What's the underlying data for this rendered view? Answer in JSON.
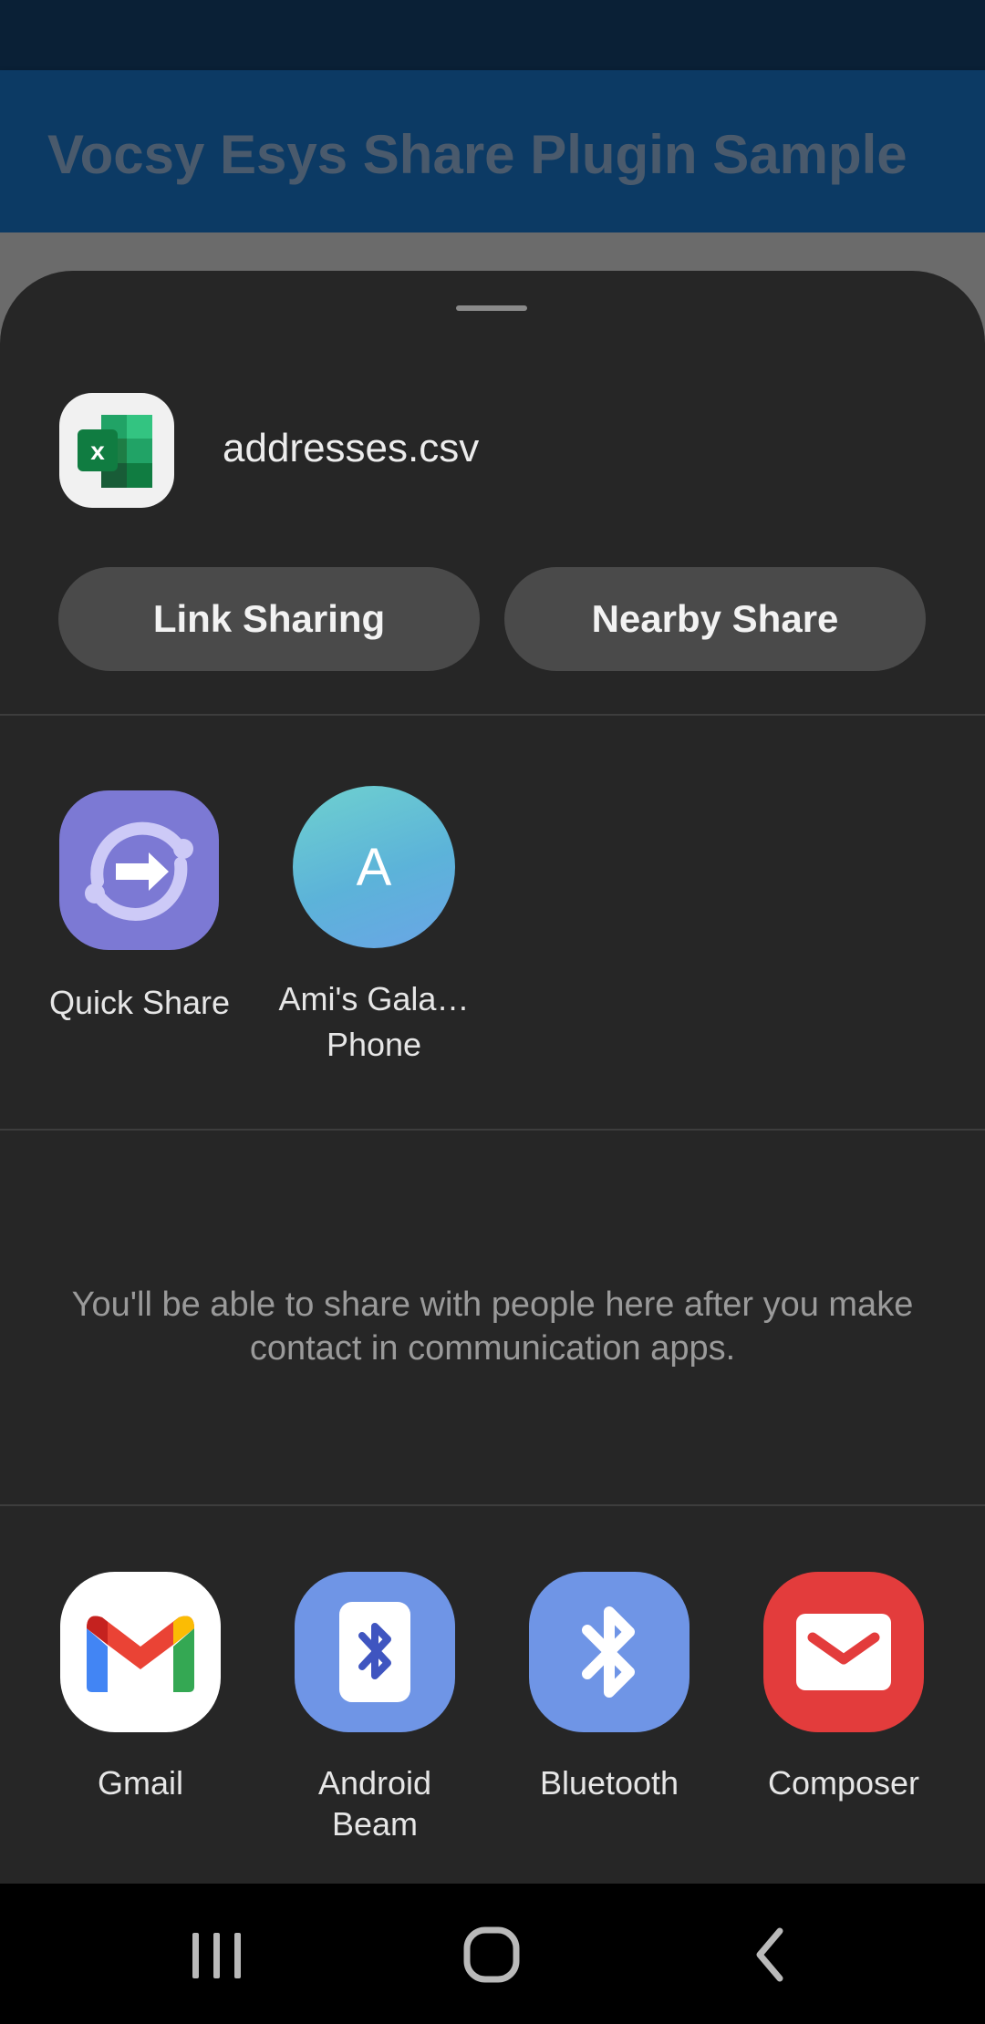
{
  "app_bar": {
    "title": "Vocsy Esys Share Plugin Sample"
  },
  "share_sheet": {
    "file": {
      "name": "addresses.csv",
      "icon": "excel-icon"
    },
    "actions": [
      {
        "label": "Link Sharing"
      },
      {
        "label": "Nearby Share"
      }
    ],
    "direct_targets": [
      {
        "label": "Quick Share",
        "icon": "quick-share-icon"
      },
      {
        "label_line1": "Ami's Gala…",
        "label_line2": "Phone",
        "avatar_letter": "A"
      }
    ],
    "empty_message": "You'll be able to share with people here after you make contact in communication apps.",
    "apps": [
      {
        "label": "Gmail",
        "icon": "gmail-icon"
      },
      {
        "label_line1": "Android",
        "label_line2": "Beam",
        "icon": "android-beam-icon"
      },
      {
        "label": "Bluetooth",
        "icon": "bluetooth-icon"
      },
      {
        "label": "Composer",
        "icon": "composer-mail-icon"
      }
    ]
  },
  "nav_bar": {
    "buttons": [
      "recents-icon",
      "home-icon",
      "back-icon"
    ]
  },
  "colors": {
    "sheet_background": "#262626",
    "app_bar": "#0c3a64",
    "pill_background": "#4a4a4a",
    "quick_share": "#7c79d4",
    "beam_bluetooth": "#6f95e6",
    "composer": "#e33c3c"
  }
}
